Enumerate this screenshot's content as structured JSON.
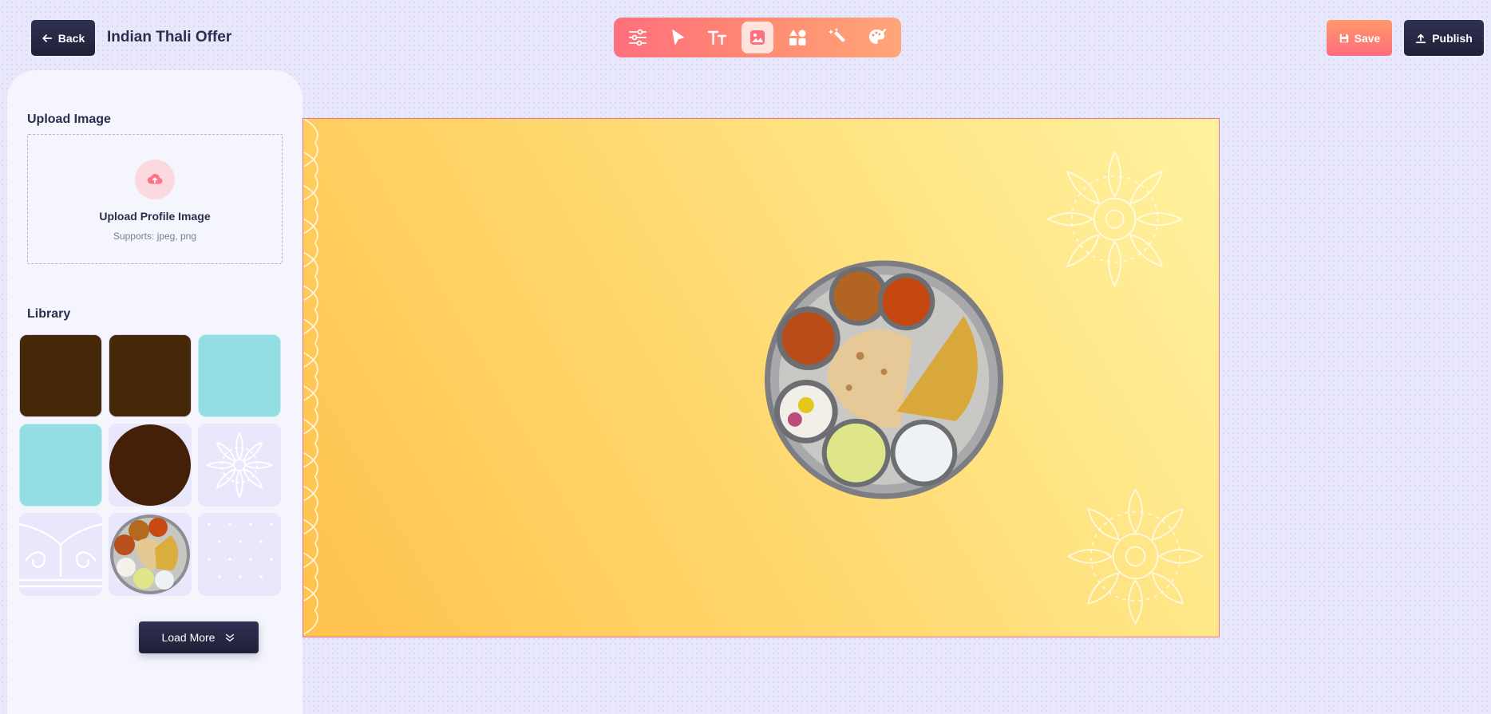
{
  "header": {
    "back_label": "Back",
    "title": "Indian Thali Offer",
    "save_label": "Save",
    "publish_label": "Publish"
  },
  "toolbar": {
    "tools": [
      {
        "icon": "sliders-icon",
        "active": false
      },
      {
        "icon": "pointer-icon",
        "active": false
      },
      {
        "icon": "text-icon",
        "active": false
      },
      {
        "icon": "image-icon",
        "active": true
      },
      {
        "icon": "shapes-icon",
        "active": false
      },
      {
        "icon": "magic-wand-icon",
        "active": false
      },
      {
        "icon": "palette-icon",
        "active": false
      }
    ],
    "accent": "#ff7a76"
  },
  "sidebar": {
    "upload_title": "Upload Image",
    "upload_label": "Upload Profile Image",
    "upload_hint": "Supports: jpeg, png",
    "library_title": "Library",
    "library_items": [
      {
        "type": "brown-rounded-square",
        "color": "#452808"
      },
      {
        "type": "brown-rounded-square",
        "color": "#452808"
      },
      {
        "type": "cyan-rounded-square",
        "color": "#92dee2"
      },
      {
        "type": "cyan-rounded-square",
        "color": "#92dee2"
      },
      {
        "type": "brown-circle",
        "color": "#452808"
      },
      {
        "type": "mandala-pattern",
        "color": "#ffffff"
      },
      {
        "type": "paisley-border",
        "color": "#ffffff"
      },
      {
        "type": "thali-plate-image"
      },
      {
        "type": "dot-pattern",
        "color": "#ffffff"
      }
    ],
    "load_more_label": "Load More"
  },
  "canvas": {
    "background": [
      "#ffc24d",
      "#fff3a0"
    ],
    "border_color": "#ef6e8a",
    "elements": [
      "left-paisley-border",
      "mandala-top-right",
      "thali-plate-image",
      "mandala-bottom-right"
    ]
  },
  "colors": {
    "dark_button": "#23253f",
    "save_button": "#ff7d74",
    "page_bg": "#e8e7fb",
    "panel_bg": "#f5f5fe"
  }
}
